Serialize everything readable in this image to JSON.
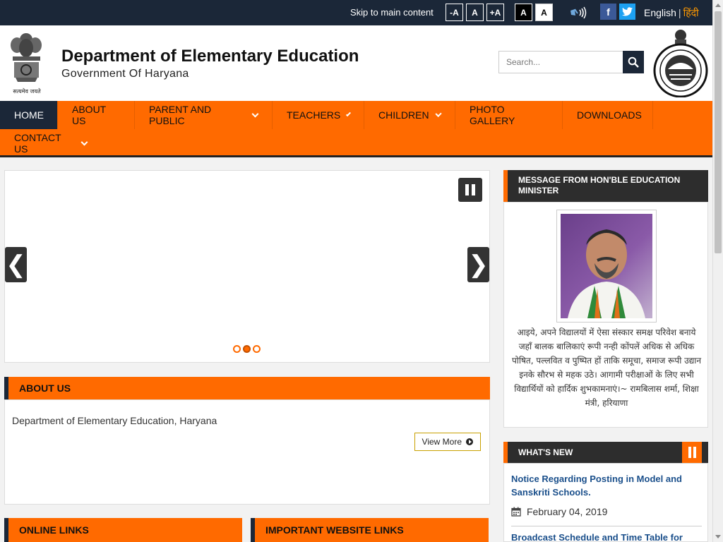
{
  "topbar": {
    "skip_link": "Skip to main content",
    "font_decrease": "-A",
    "font_normal": "A",
    "font_increase": "+A",
    "contrast_dark": "A",
    "contrast_light": "A",
    "facebook": "f",
    "twitter": "t",
    "lang_english": "English",
    "lang_separator": "|",
    "lang_hindi": "हिंदी"
  },
  "header": {
    "emblem_motto": "सत्यमेव जयते",
    "title": "Department of Elementary Education",
    "subtitle": "Government Of Haryana",
    "search_placeholder": "Search..."
  },
  "nav": {
    "items": [
      {
        "label": "HOME",
        "active": true,
        "dropdown": false
      },
      {
        "label": "ABOUT US",
        "active": false,
        "dropdown": false
      },
      {
        "label": "PARENT AND PUBLIC",
        "active": false,
        "dropdown": true
      },
      {
        "label": "TEACHERS",
        "active": false,
        "dropdown": true
      },
      {
        "label": "CHILDREN",
        "active": false,
        "dropdown": true
      },
      {
        "label": "PHOTO GALLERY",
        "active": false,
        "dropdown": false
      },
      {
        "label": "DOWNLOADS",
        "active": false,
        "dropdown": false
      },
      {
        "label": "CONTACT US",
        "active": false,
        "dropdown": true
      }
    ]
  },
  "slider": {
    "prev": "❮",
    "next": "❯",
    "dots": 3,
    "active_dot": 2
  },
  "about": {
    "heading": "ABOUT US",
    "text": "Department of Elementary Education, Haryana",
    "view_more": "View More"
  },
  "bottom_sections": {
    "online_links": "ONLINE LINKS",
    "important_links": "IMPORTANT WEBSITE LINKS"
  },
  "minister": {
    "heading": "MESSAGE FROM HON'BLE EDUCATION MINISTER",
    "message": "आइये, अपने विद्यालयों में ऐसा संस्कार समक्ष परिवेश बनाये जहाँ बालक बालिकाएं रूपी नन्ही कोंपलें अधिक से अधिक पोषित, पल्लवित व पुष्पित हों ताकि समूचा, समाज रूपी उद्यान इनके सौरभ से महक उठे। आगामी परीक्षाओं के लिए सभी विद्यार्थियों को हार्दिक शुभकामनाएं।~ रामबिलास शर्मा, शिक्षा मंत्री, हरियाणा"
  },
  "whats_new": {
    "heading": "WHAT'S NEW",
    "items": [
      {
        "title": "Notice Regarding Posting in Model and Sanskriti Schools.",
        "date": "February 04, 2019"
      },
      {
        "title": "Broadcast Schedule and Time Table for"
      }
    ]
  },
  "colors": {
    "accent": "#ff6a00",
    "dark": "#1b2738",
    "link": "#1a4f8b"
  }
}
